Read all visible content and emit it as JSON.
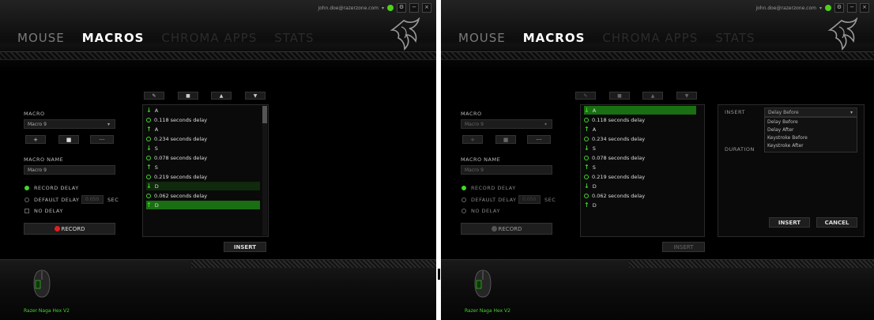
{
  "left": {
    "account": "john.doe@razerzone.com",
    "nav": [
      "MOUSE",
      "MACROS",
      "CHROMA APPS",
      "STATS"
    ],
    "macro_label": "MACRO",
    "macro_value": "Macro 9",
    "macro_buttons": [
      "+",
      "■",
      "···"
    ],
    "macro_name_label": "MACRO NAME",
    "macro_name_value": "Macro 9",
    "options": [
      "RECORD DELAY",
      "DEFAULT DELAY",
      "NO DELAY"
    ],
    "default_delay_value": "0.050",
    "sec_label": "SEC",
    "record_label": "RECORD",
    "toolbar": [
      "✎",
      "■",
      "▲",
      "▼"
    ],
    "events": [
      {
        "type": "down",
        "text": "A"
      },
      {
        "type": "delay",
        "text": "0.118 seconds delay"
      },
      {
        "type": "up",
        "text": "A"
      },
      {
        "type": "delay",
        "text": "0.234 seconds delay"
      },
      {
        "type": "down",
        "text": "S"
      },
      {
        "type": "delay",
        "text": "0.078 seconds delay"
      },
      {
        "type": "up",
        "text": "S"
      },
      {
        "type": "delay",
        "text": "0.219 seconds delay"
      },
      {
        "type": "down",
        "text": "D"
      },
      {
        "type": "delay",
        "text": "0.062 seconds delay"
      },
      {
        "type": "up",
        "text": "D"
      }
    ],
    "insert_label": "INSERT",
    "device": "Razer Naga Hex V2"
  },
  "right": {
    "account": "john.doe@razerzone.com",
    "nav": [
      "MOUSE",
      "MACROS",
      "CHROMA APPS",
      "STATS"
    ],
    "macro_label": "MACRO",
    "macro_value": "Macro 9",
    "macro_buttons": [
      "+",
      "■",
      "···"
    ],
    "macro_name_label": "MACRO NAME",
    "macro_name_value": "Macro 9",
    "options": [
      "RECORD DELAY",
      "DEFAULT DELAY",
      "NO DELAY"
    ],
    "default_delay_value": "0.050",
    "sec_label": "SEC",
    "record_label": "RECORD",
    "toolbar": [
      "✎",
      "■",
      "▲",
      "▼"
    ],
    "events": [
      {
        "type": "down",
        "text": "A"
      },
      {
        "type": "delay",
        "text": "0.118 seconds delay"
      },
      {
        "type": "up",
        "text": "A"
      },
      {
        "type": "delay",
        "text": "0.234 seconds delay"
      },
      {
        "type": "down",
        "text": "S"
      },
      {
        "type": "delay",
        "text": "0.078 seconds delay"
      },
      {
        "type": "up",
        "text": "S"
      },
      {
        "type": "delay",
        "text": "0.219 seconds delay"
      },
      {
        "type": "down",
        "text": "D"
      },
      {
        "type": "delay",
        "text": "0.062 seconds delay"
      },
      {
        "type": "up",
        "text": "D"
      }
    ],
    "insert_label": "INSERT",
    "side_insert_label": "INSERT",
    "side_insert_value": "Delay Before",
    "dropdown_options": [
      "Delay Before",
      "Delay After",
      "Keystroke Before",
      "Keystroke After"
    ],
    "duration_label": "DURATION",
    "insert_button": "INSERT",
    "cancel_button": "CANCEL",
    "device": "Razer Naga Hex V2"
  },
  "colors": {
    "accent": "#44d62c",
    "record": "#e02020",
    "background": "#000000"
  }
}
